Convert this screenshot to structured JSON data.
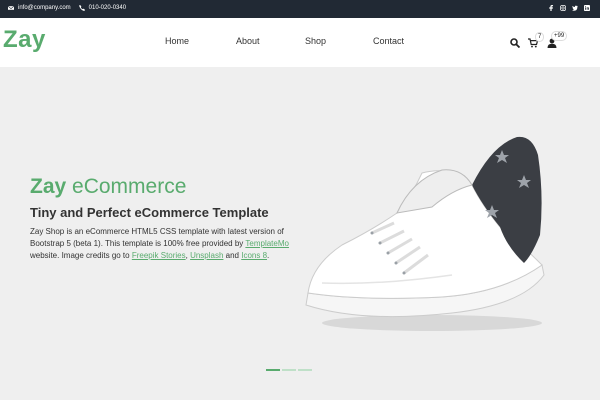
{
  "topbar": {
    "email": "info@company.com",
    "phone": "010-020-0340",
    "social_icons": [
      "facebook-icon",
      "instagram-icon",
      "twitter-icon",
      "linkedin-icon"
    ]
  },
  "brand": {
    "logo": "Zay"
  },
  "nav": {
    "items": [
      "Home",
      "About",
      "Shop",
      "Contact"
    ]
  },
  "header_icons": {
    "search": "search-icon",
    "cart": "cart-icon",
    "cart_count": "7",
    "user": "user-icon",
    "user_count": "+99"
  },
  "hero": {
    "title_bold": "Zay",
    "title_rest": " eCommerce",
    "subtitle": "Tiny and Perfect eCommerce Template",
    "desc_1": "Zay Shop is an eCommerce HTML5 CSS template with latest version of Bootstrap 5 (beta 1). This template is 100% free provided by ",
    "link_templatemo": "TemplateMo",
    "desc_2": " website. Image credits go to ",
    "link_freepik": "Freepik Stories",
    "desc_3": ", ",
    "link_unsplash": "Unsplash",
    "desc_4": " and ",
    "link_icons8": "Icons 8",
    "desc_5": "."
  },
  "carousel": {
    "slides": 3,
    "active": 1
  },
  "colors": {
    "brand_green": "#59ab6e",
    "topbar_bg": "#212934",
    "hero_bg": "#efefef"
  }
}
